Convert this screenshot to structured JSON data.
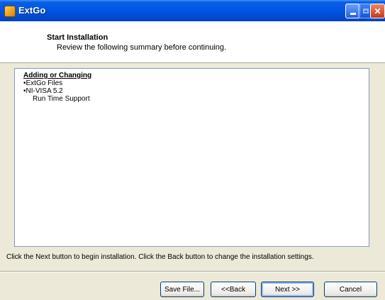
{
  "window": {
    "title": "ExtGo"
  },
  "header": {
    "title": "Start Installation",
    "subtitle": "Review the following summary before continuing."
  },
  "summary": {
    "heading": "Adding or Changing",
    "lines": [
      "•ExtGo Files",
      "•NI-VISA 5.2",
      "Run Time Support"
    ]
  },
  "instruction": "Click the Next button to begin installation.  Click the Back button to change the installation settings.",
  "buttons": {
    "save": "Save File...",
    "back": "<<Back",
    "next": "Next >>",
    "cancel": "Cancel"
  }
}
